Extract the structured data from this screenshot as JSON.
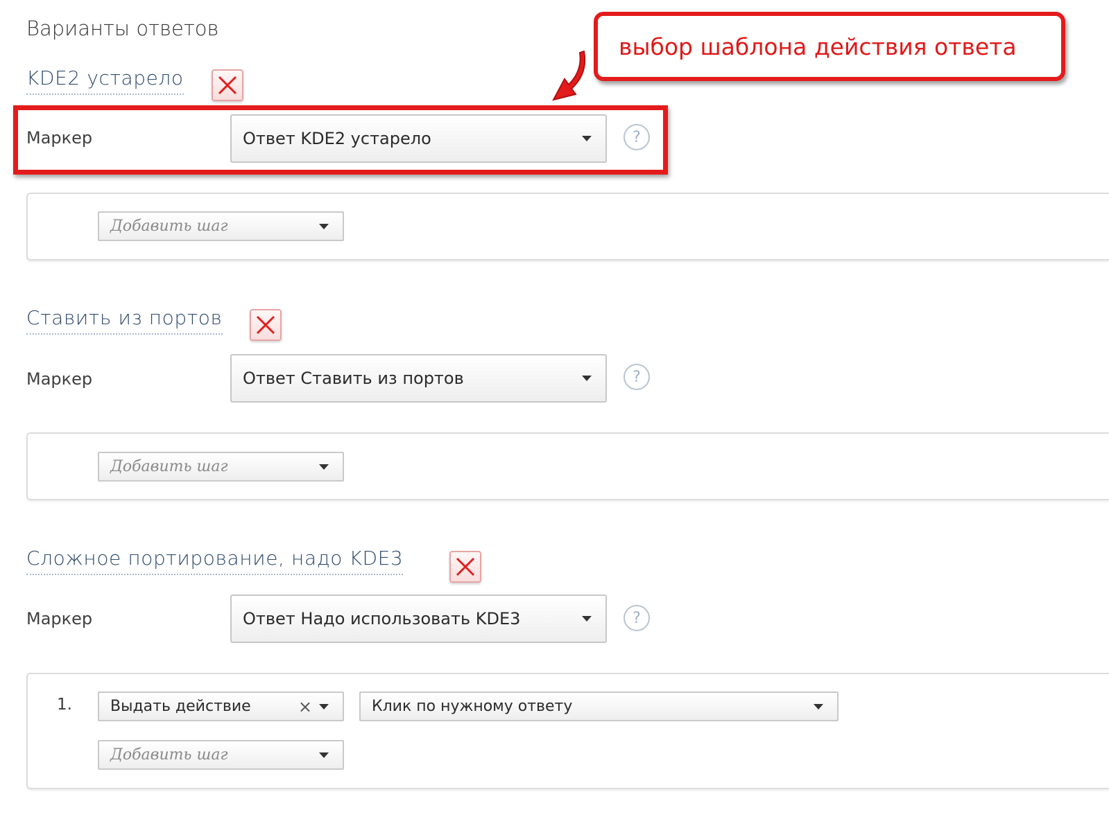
{
  "page_title": "Варианты ответов",
  "callout": {
    "text": "выбор шаблона действия ответа"
  },
  "answers": [
    {
      "title": "KDE2 устарело",
      "marker_label": "Маркер",
      "marker_value": "Ответ KDE2 устарело",
      "help": "?",
      "add_step_placeholder": "Добавить шаг"
    },
    {
      "title": "Ставить из портов",
      "marker_label": "Маркер",
      "marker_value": "Ответ Ставить из портов",
      "help": "?",
      "add_step_placeholder": "Добавить шаг"
    },
    {
      "title": "Сложное портирование, надо KDE3",
      "marker_label": "Маркер",
      "marker_value": "Ответ Надо использовать KDE3",
      "help": "?",
      "steps": [
        {
          "number": "1.",
          "action": "Выдать действие",
          "clear": "×",
          "target": "Клик по нужному ответу"
        }
      ],
      "add_step_placeholder": "Добавить шаг"
    }
  ],
  "colors": {
    "annotation_red": "#e41b1b",
    "title_blue": "#2f4a6b"
  },
  "icons": {
    "close": "close-icon",
    "help": "help-icon",
    "caret": "chevron-down-icon",
    "arrow": "arrow-annotation-icon"
  }
}
